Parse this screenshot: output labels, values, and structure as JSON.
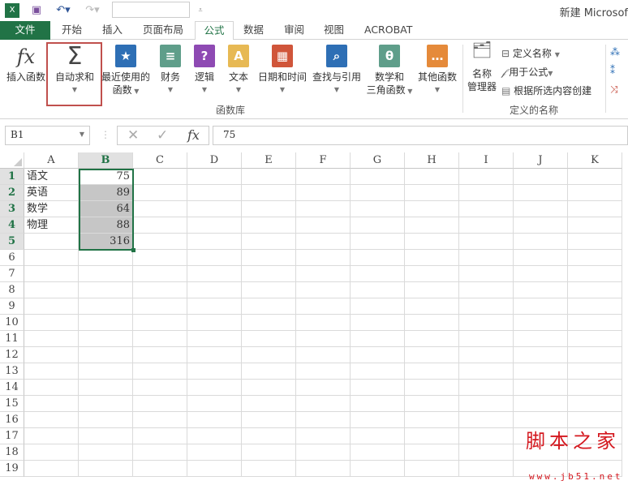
{
  "titlebar": {
    "title": "新建 Microsof"
  },
  "tabs": [
    "文件",
    "开始",
    "插入",
    "页面布局",
    "公式",
    "数据",
    "审阅",
    "视图",
    "ACROBAT"
  ],
  "ribbon": {
    "insert_function": "插入函数",
    "autosum": "自动求和",
    "recent": [
      "最近使用的",
      "函数"
    ],
    "financial": "财务",
    "logical": "逻辑",
    "text": "文本",
    "datetime": "日期和时间",
    "lookup": "查找与引用",
    "math": [
      "数学和",
      "三角函数"
    ],
    "more": "其他函数",
    "group_library": "函数库",
    "name_manager": [
      "名称",
      "管理器"
    ],
    "define_name": "定义名称",
    "use_in_formula": "用于公式",
    "create_from_selection": "根据所选内容创建",
    "group_names": "定义的名称"
  },
  "formula_bar": {
    "name_box": "B1",
    "value": "75"
  },
  "columns": [
    "A",
    "B",
    "C",
    "D",
    "E",
    "F",
    "G",
    "H",
    "I",
    "J",
    "K"
  ],
  "rows": [
    [
      "语文",
      "75"
    ],
    [
      "英语",
      "89"
    ],
    [
      "数学",
      "64"
    ],
    [
      "物理",
      "88"
    ],
    [
      "",
      "316"
    ]
  ],
  "row_count": 19,
  "watermark": {
    "title": "脚本之家",
    "url": "www.jb51.net"
  }
}
